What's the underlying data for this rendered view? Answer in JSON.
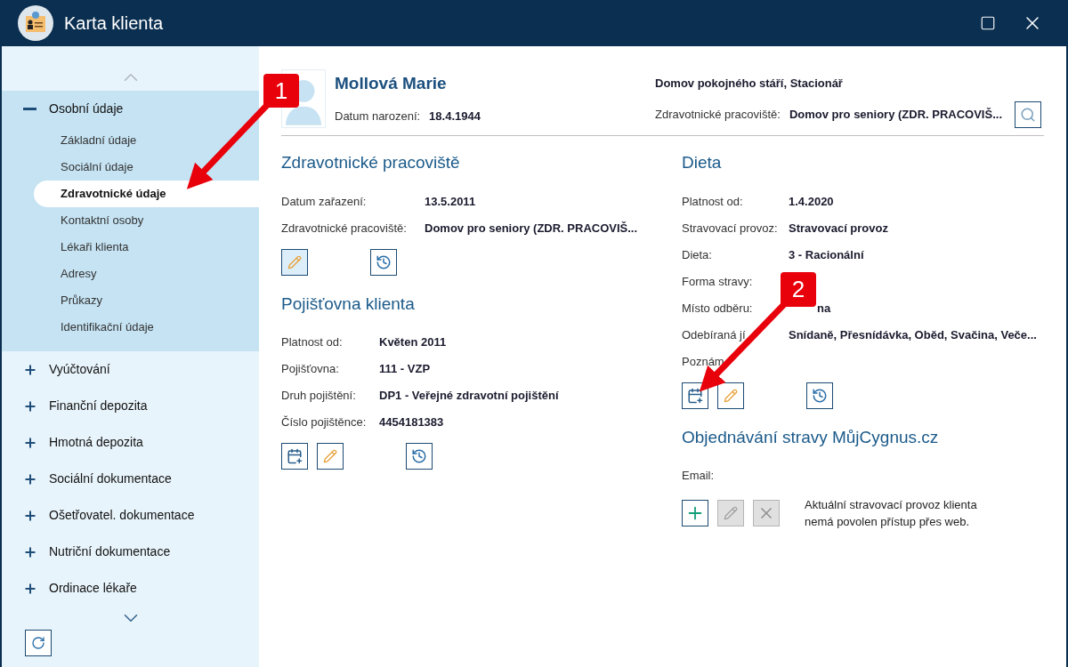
{
  "window": {
    "title": "Karta klienta"
  },
  "sidebar": {
    "items": [
      {
        "label": "Osobní údaje",
        "expanded": true,
        "children": [
          {
            "label": "Základní údaje",
            "selected": false
          },
          {
            "label": "Sociální údaje",
            "selected": false
          },
          {
            "label": "Zdravotnické údaje",
            "selected": true
          },
          {
            "label": "Kontaktní osoby",
            "selected": false
          },
          {
            "label": "Lékaři klienta",
            "selected": false
          },
          {
            "label": "Adresy",
            "selected": false
          },
          {
            "label": "Průkazy",
            "selected": false
          },
          {
            "label": "Identifikační údaje",
            "selected": false
          }
        ]
      },
      {
        "label": "Vyúčtování",
        "expanded": false
      },
      {
        "label": "Finanční depozita",
        "expanded": false
      },
      {
        "label": "Hmotná depozita",
        "expanded": false
      },
      {
        "label": "Sociální dokumentace",
        "expanded": false
      },
      {
        "label": "Ošetřovatel. dokumentace",
        "expanded": false
      },
      {
        "label": "Nutriční dokumentace",
        "expanded": false
      },
      {
        "label": "Ordinace lékaře",
        "expanded": false
      }
    ]
  },
  "client": {
    "name": "Mollová Marie",
    "birth_label": "Datum narození:",
    "birth_value": "18.4.1944",
    "facility": "Domov pokojného stáří, Stacionář",
    "workplace_label": "Zdravotnické pracoviště:",
    "workplace_value": "Domov pro seniory (ZDR. PRACOVIŠ..."
  },
  "left_sections": [
    {
      "title": "Zdravotnické pracoviště",
      "fields": [
        {
          "label": "Datum zařazení:",
          "value": "13.5.2011"
        },
        {
          "label": "Zdravotnické pracoviště:",
          "value": "Domov pro seniory (ZDR. PRACOVIŠ..."
        }
      ],
      "buttons": [
        {
          "kind": "edit",
          "highlighted": true,
          "disabled": false
        },
        {
          "kind": "gap"
        },
        {
          "kind": "history",
          "highlighted": false,
          "disabled": false
        }
      ]
    },
    {
      "title": "Pojišťovna klienta",
      "fields": [
        {
          "label": "Platnost od:",
          "value": "Květen 2011"
        },
        {
          "label": "Pojišťovna:",
          "value": "111 - VZP"
        },
        {
          "label": "Druh pojištění:",
          "value": "DP1 - Veřejné zdravotní pojištění"
        },
        {
          "label": "Číslo pojištěnce:",
          "value": "4454181383"
        }
      ],
      "buttons": [
        {
          "kind": "add_period",
          "highlighted": false,
          "disabled": false
        },
        {
          "kind": "edit",
          "highlighted": false,
          "disabled": false
        },
        {
          "kind": "gap"
        },
        {
          "kind": "history",
          "highlighted": false,
          "disabled": false
        }
      ]
    }
  ],
  "right_sections": [
    {
      "title": "Dieta",
      "fields": [
        {
          "label": "Platnost od:",
          "value": "1.4.2020"
        },
        {
          "label": "Stravovací provoz:",
          "value": "Stravovací provoz"
        },
        {
          "label": "Dieta:",
          "value": "3 - Racionální"
        },
        {
          "label": "Forma stravy:"
        },
        {
          "label": "Místo odběru:",
          "value": "na",
          "covered": true
        },
        {
          "label": "Odebíraná jí",
          "value": "Snídaně, Přesnídávka, Oběd, Svačina, Veče..."
        },
        {
          "label": "Poznám"
        }
      ],
      "buttons": [
        {
          "kind": "add_period",
          "highlighted": false,
          "disabled": false
        },
        {
          "kind": "edit",
          "highlighted": false,
          "disabled": false
        },
        {
          "kind": "gap"
        },
        {
          "kind": "history",
          "highlighted": false,
          "disabled": false
        }
      ]
    },
    {
      "title": "Objednávání stravy MůjCygnus.cz",
      "fields": [
        {
          "label": "Email:"
        }
      ],
      "buttons": [
        {
          "kind": "add",
          "highlighted": false,
          "disabled": false
        },
        {
          "kind": "edit",
          "disabled": true
        },
        {
          "kind": "delete",
          "disabled": true
        }
      ],
      "note": "Aktuální stravovací provoz klienta nemá povolen přístup přes web."
    }
  ],
  "callouts": [
    {
      "number": "1"
    },
    {
      "number": "2"
    }
  ]
}
